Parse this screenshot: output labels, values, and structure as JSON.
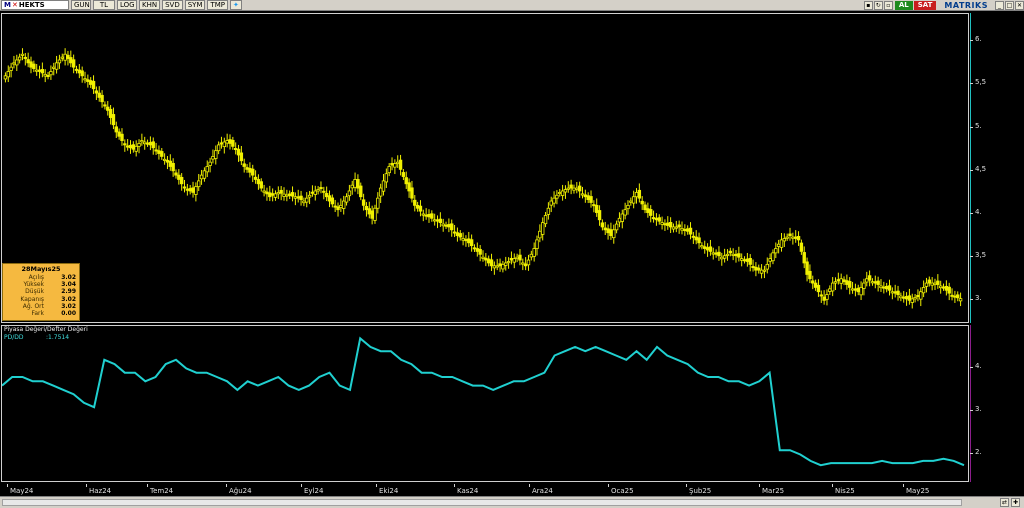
{
  "toolbar": {
    "symbol_prefix": "M",
    "symbol_rest": "HEKTS",
    "buttons": [
      "GUN",
      "TL",
      "LOG",
      "KHN",
      "SVD",
      "SYM",
      "TMP"
    ],
    "al_label": "AL",
    "sat_label": "SAT",
    "brand": "MATRIKS",
    "colors": {
      "al": "#1e8a1e",
      "sat": "#c81e1e"
    }
  },
  "info_box": {
    "date": "28Mayıs25",
    "rows": [
      {
        "label": "Açılış",
        "value": "3.02"
      },
      {
        "label": "Yüksek",
        "value": "3.04"
      },
      {
        "label": "Düşük",
        "value": "2.99"
      },
      {
        "label": "Kapanış",
        "value": "3.02"
      },
      {
        "label": "Ağ. Ort",
        "value": "3.02"
      },
      {
        "label": "Fark",
        "value": "0.00"
      }
    ]
  },
  "pd_panel": {
    "title": "Piyasa Değeri/Defter Değeri",
    "series_label": "PD/DD",
    "value": ":1.7514"
  },
  "x_axis": {
    "labels": [
      "May24",
      "Haz24",
      "Tem24",
      "Ağu24",
      "Eyl24",
      "Eki24",
      "Kas24",
      "Ara24",
      "Oca25",
      "Şub25",
      "Mar25",
      "Nis25",
      "May25"
    ]
  },
  "chart_data": [
    {
      "type": "candlestick",
      "title": "",
      "y_ticks": [
        "6.",
        "5,5",
        "5.",
        "4,5",
        "4.",
        "3,5",
        "3."
      ],
      "ylim": [
        2.9,
        6.2
      ],
      "colors": {
        "candle": "#f0f000",
        "axis_line": "#20c0c0"
      },
      "close_series": [
        5.6,
        5.75,
        5.85,
        5.7,
        5.65,
        5.6,
        5.75,
        5.85,
        5.7,
        5.6,
        5.5,
        5.35,
        5.2,
        4.95,
        4.8,
        4.75,
        4.85,
        4.8,
        4.7,
        4.6,
        4.45,
        4.3,
        4.25,
        4.45,
        4.6,
        4.8,
        4.85,
        4.75,
        4.55,
        4.45,
        4.3,
        4.2,
        4.25,
        4.22,
        4.2,
        4.15,
        4.25,
        4.3,
        4.15,
        4.05,
        4.2,
        4.4,
        4.1,
        3.95,
        4.3,
        4.55,
        4.6,
        4.35,
        4.1,
        4.0,
        3.95,
        3.9,
        3.85,
        3.75,
        3.7,
        3.6,
        3.5,
        3.4,
        3.4,
        3.45,
        3.5,
        3.4,
        3.6,
        3.9,
        4.15,
        4.25,
        4.3,
        4.3,
        4.2,
        4.1,
        3.85,
        3.75,
        3.95,
        4.1,
        4.25,
        4.05,
        3.95,
        3.9,
        3.85,
        3.85,
        3.8,
        3.7,
        3.6,
        3.55,
        3.5,
        3.55,
        3.5,
        3.45,
        3.35,
        3.35,
        3.55,
        3.7,
        3.75,
        3.7,
        3.3,
        3.15,
        3.0,
        3.2,
        3.25,
        3.15,
        3.1,
        3.25,
        3.2,
        3.15,
        3.1,
        3.05,
        3.0,
        3.05,
        3.2,
        3.2,
        3.15,
        3.05,
        3.02
      ]
    },
    {
      "type": "line",
      "title": "",
      "y_ticks": [
        "4.",
        "3.",
        "2."
      ],
      "ylim": [
        1.5,
        4.8
      ],
      "colors": {
        "line": "#20d0d0",
        "axis_line": "#8c1e8c"
      },
      "values": [
        3.6,
        3.8,
        3.8,
        3.7,
        3.7,
        3.6,
        3.5,
        3.4,
        3.2,
        3.1,
        4.2,
        4.1,
        3.9,
        3.9,
        3.7,
        3.8,
        4.1,
        4.2,
        4.0,
        3.9,
        3.9,
        3.8,
        3.7,
        3.5,
        3.7,
        3.6,
        3.7,
        3.8,
        3.6,
        3.5,
        3.6,
        3.8,
        3.9,
        3.6,
        3.5,
        4.7,
        4.5,
        4.4,
        4.4,
        4.2,
        4.1,
        3.9,
        3.9,
        3.8,
        3.8,
        3.7,
        3.6,
        3.6,
        3.5,
        3.6,
        3.7,
        3.7,
        3.8,
        3.9,
        4.3,
        4.4,
        4.5,
        4.4,
        4.5,
        4.4,
        4.3,
        4.2,
        4.4,
        4.2,
        4.5,
        4.3,
        4.2,
        4.1,
        3.9,
        3.8,
        3.8,
        3.7,
        3.7,
        3.6,
        3.7,
        3.9,
        2.1,
        2.1,
        2.0,
        1.85,
        1.75,
        1.8,
        1.8,
        1.8,
        1.8,
        1.8,
        1.85,
        1.8,
        1.8,
        1.8,
        1.85,
        1.85,
        1.9,
        1.85,
        1.75
      ]
    }
  ]
}
